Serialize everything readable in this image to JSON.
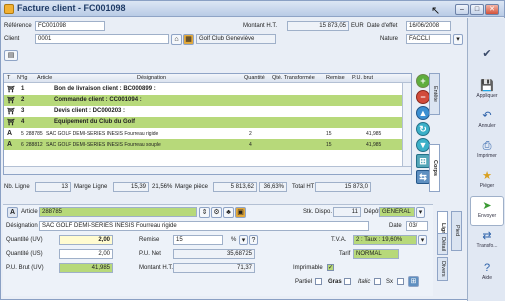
{
  "window": {
    "title": "Facture client - FC001098"
  },
  "header": {
    "reference_label": "Référence",
    "reference_value": "FC001098",
    "client_label": "Client",
    "client_value": "0001",
    "client_name": "Golf Club Geneviève",
    "montant_label": "Montant H.T.",
    "montant_value": "15 873,05",
    "currency": "EUR",
    "date_label": "Date d'effet",
    "date_value": "16/06/2008",
    "nature_label": "Nature",
    "nature_value": "FACCLI"
  },
  "grid": {
    "columns": [
      "T",
      "N°lg",
      "Article",
      "Désignation",
      "Quantité",
      "Qté. Transformée",
      "Remise",
      "P.U. brut"
    ],
    "rows": [
      {
        "t": "⛩",
        "n": "1",
        "article": "",
        "designation": "Bon de livraison client : BC000899 :",
        "qty": "",
        "qtt": "",
        "remise": "",
        "pu": "",
        "style": "bold"
      },
      {
        "t": "⛩",
        "n": "2",
        "article": "",
        "designation": "Commande client : CC001094 :",
        "qty": "",
        "qtt": "",
        "remise": "",
        "pu": "",
        "style": "bold-hl"
      },
      {
        "t": "⛩",
        "n": "3",
        "article": "",
        "designation": "Devis client : DC000203 :",
        "qty": "",
        "qtt": "",
        "remise": "",
        "pu": "",
        "style": "bold"
      },
      {
        "t": "⛩",
        "n": "4",
        "article": "",
        "designation": "Equipement du Club du Golf",
        "qty": "",
        "qtt": "",
        "remise": "",
        "pu": "",
        "style": "bold-hl"
      },
      {
        "t": "A",
        "n": "5",
        "article": "288785",
        "designation": "SAC GOLF DEMI-SERIES INESIS Fourreau rigide",
        "qty": "2",
        "qtt": "",
        "remise": "15",
        "pu": "41,985",
        "style": "small"
      },
      {
        "t": "A",
        "n": "6",
        "article": "288812",
        "designation": "SAC GOLF DEMI-SERIES INESIS Fourreau souple",
        "qty": "4",
        "qtt": "",
        "remise": "15",
        "pu": "41,985",
        "style": "small-hl"
      }
    ]
  },
  "totals": {
    "nb_ligne_label": "Nb. Ligne",
    "nb_ligne_value": "13",
    "marge_ligne_label": "Marge Ligne",
    "marge_ligne_value": "15,39",
    "marge_ligne_pct": "21,56%",
    "marge_piece_label": "Marge pièce",
    "marge_piece_value": "5 813,62",
    "marge_piece_pct": "36,63%",
    "total_ht_label": "Total HT",
    "total_ht_value": "15 873,0"
  },
  "detail": {
    "article_label": "Article",
    "article_value": "288785",
    "stk_label": "Stk. Dispo.",
    "stk_value": "11",
    "depot_label": "Dépôt",
    "depot_value": "GENERAL",
    "designation_label": "Désignation",
    "designation_value": "SAC GOLF DEMI-SERIES INESIS Fourreau rigide",
    "date_label": "Date",
    "date_value": "03/",
    "qty_uv_label": "Quantité (UV)",
    "qty_uv_value": "2,00",
    "remise_label": "Remise",
    "remise_value": "15",
    "remise_unit": "%",
    "tva_label": "T.V.A.",
    "tva_value": "2 : Taux : 19,60%",
    "qty_us_label": "Quantité (US)",
    "qty_us_value": "2,00",
    "pu_net_label": "P.U. Net",
    "pu_net_value": "35,68725",
    "tarif_label": "Tarif",
    "tarif_value": "NORMAL",
    "pu_brut_label": "P.U. Brut (UV)",
    "pu_brut_value": "41,985",
    "montant_label": "Montant H.T.",
    "montant_value": "71,37",
    "imprimable_label": "Imprimable",
    "partiel_label": "Partiel",
    "gras_label": "Gras",
    "italic_label": "Italic",
    "sx_label": "Sx"
  },
  "side_tabs": {
    "entete": "Entête",
    "corps": "Corps",
    "ligne": "Ligne",
    "detail": "Détail",
    "divers": "Divers",
    "pied": "Pied"
  },
  "right_panel": {
    "buttons": [
      {
        "label": "",
        "icon": "check-icon"
      },
      {
        "label": "Appliquer",
        "icon": "save-icon"
      },
      {
        "label": "Annuler",
        "icon": "undo-icon"
      },
      {
        "label": "Imprimer",
        "icon": "printer-icon"
      },
      {
        "label": "Piéger",
        "icon": "star-icon"
      },
      {
        "label": "Envoyer",
        "icon": "send-icon"
      },
      {
        "label": "Transfo...",
        "icon": "transform-icon"
      },
      {
        "label": "Aide",
        "icon": "help-icon"
      }
    ]
  }
}
